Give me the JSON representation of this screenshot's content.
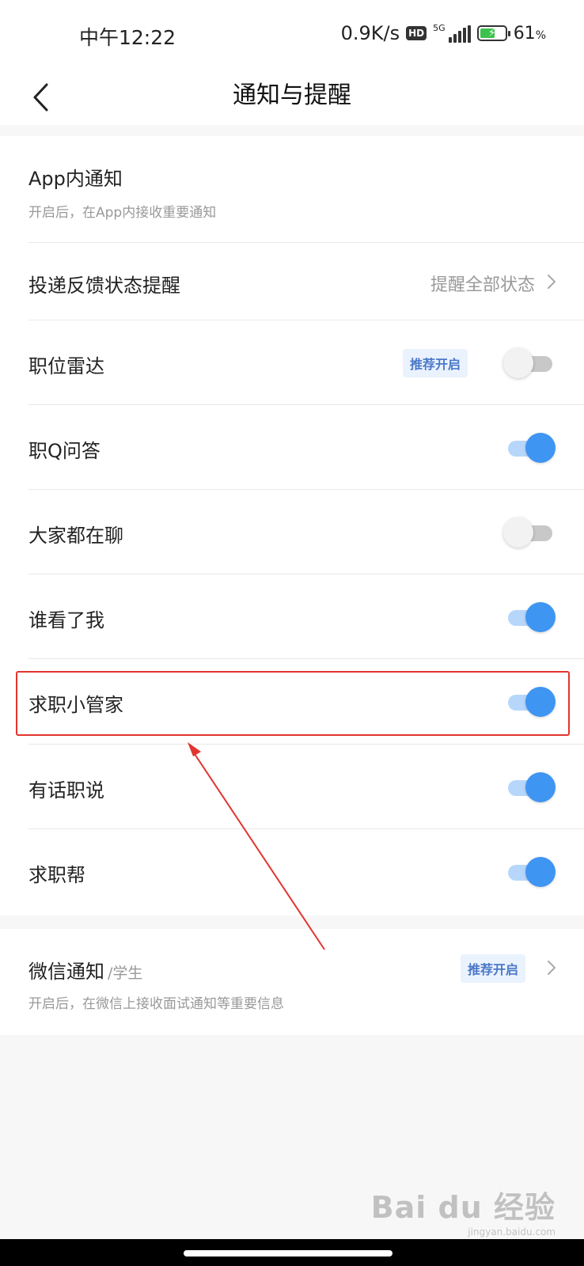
{
  "status_bar": {
    "time": "中午12:22",
    "net_speed": "0.9K/s",
    "hd": "HD",
    "network": "5G",
    "battery_percent": "61",
    "battery_unit": "%",
    "battery_level": 0.61
  },
  "header": {
    "title": "通知与提醒"
  },
  "settings": {
    "app_notify": {
      "label": "App内通知",
      "desc": "开启后，在App内接收重要通知"
    },
    "delivery_feedback": {
      "label": "投递反馈状态提醒",
      "value": "提醒全部状态"
    },
    "job_radar": {
      "label": "职位雷达",
      "badge": "推荐开启",
      "enabled": false
    },
    "job_qa": {
      "label": "职Q问答",
      "enabled": true
    },
    "everyone_chat": {
      "label": "大家都在聊",
      "enabled": false
    },
    "who_viewed": {
      "label": "谁看了我",
      "enabled": true
    },
    "job_assistant": {
      "label": "求职小管家",
      "enabled": true
    },
    "job_talk": {
      "label": "有话职说",
      "enabled": true
    },
    "job_help": {
      "label": "求职帮",
      "enabled": true
    }
  },
  "wechat": {
    "label": "微信通知",
    "sub": "/学生",
    "badge": "推荐开启",
    "desc": "开启后，在微信上接收面试通知等重要信息"
  },
  "watermark": {
    "logo": "Bai du 经验",
    "url": "jingyan.baidu.com"
  },
  "colors": {
    "accent": "#3f95f2",
    "highlight": "#e1352f",
    "badge_bg": "#eaf2fd",
    "badge_text": "#4a78c8"
  }
}
